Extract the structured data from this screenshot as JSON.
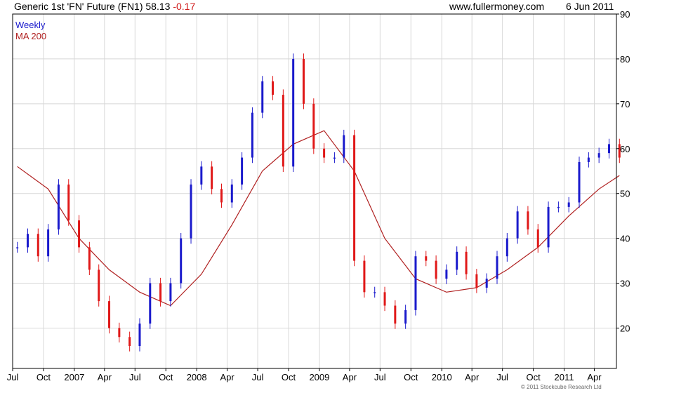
{
  "header": {
    "instrument": "Generic 1st 'FN' Future (FN1)",
    "last": "58.13",
    "change": "-0.17",
    "site": "www.fullermoney.com",
    "date": "6 Jun 2011"
  },
  "colors": {
    "up": "#1a1acc",
    "down": "#e01818",
    "ma": "#b02020",
    "grid": "#d8d8d8"
  },
  "copyright": "© 2011 Stockcube Research Ltd",
  "chart_data": {
    "type": "line",
    "title": "Generic 1st 'FN' Future (FN1) 58.13 -0.17",
    "legend": [
      "Weekly",
      "MA 200"
    ],
    "legend_position": "top-left",
    "ylim": [
      11,
      90
    ],
    "yticks": [
      20,
      30,
      40,
      50,
      60,
      70,
      80,
      90
    ],
    "grid": true,
    "xtick_labels": [
      "Jul",
      "Oct",
      "2007",
      "Apr",
      "Jul",
      "Oct",
      "2008",
      "Apr",
      "Jul",
      "Oct",
      "2009",
      "Apr",
      "Jul",
      "Oct",
      "2010",
      "Apr",
      "Jul",
      "Oct",
      "2011",
      "Apr"
    ],
    "x_start": "2006-07-01",
    "x_end": "2011-06-06",
    "series": [
      {
        "name": "Weekly",
        "x": [
          "2006-07",
          "2006-08",
          "2006-09",
          "2006-10",
          "2006-11",
          "2006-12",
          "2007-01",
          "2007-02",
          "2007-03",
          "2007-04",
          "2007-05",
          "2007-06",
          "2007-07",
          "2007-08",
          "2007-09",
          "2007-10",
          "2007-11",
          "2007-12",
          "2008-01",
          "2008-02",
          "2008-03",
          "2008-04",
          "2008-05",
          "2008-06",
          "2008-07",
          "2008-08",
          "2008-09",
          "2008-10",
          "2008-11",
          "2008-12",
          "2009-01",
          "2009-02",
          "2009-03",
          "2009-04",
          "2009-05",
          "2009-06",
          "2009-07",
          "2009-08",
          "2009-09",
          "2009-10",
          "2009-11",
          "2009-12",
          "2010-01",
          "2010-02",
          "2010-03",
          "2010-04",
          "2010-05",
          "2010-06",
          "2010-07",
          "2010-08",
          "2010-09",
          "2010-10",
          "2010-11",
          "2010-12",
          "2011-01",
          "2011-02",
          "2011-03",
          "2011-04",
          "2011-05",
          "2011-06"
        ],
        "values": [
          38,
          41,
          36,
          42,
          52,
          44,
          38,
          33,
          26,
          20,
          18,
          16,
          21,
          30,
          26,
          30,
          40,
          52,
          56,
          51,
          48,
          52,
          58,
          68,
          75,
          72,
          56,
          80,
          70,
          60,
          58,
          58,
          63,
          35,
          28,
          28,
          25,
          21,
          24,
          36,
          35,
          31,
          33,
          37,
          32,
          29,
          31,
          36,
          40,
          46,
          42,
          38,
          47,
          47,
          48,
          57,
          58,
          59,
          61,
          58
        ]
      },
      {
        "name": "MA 200",
        "x": [
          "2006-07",
          "2006-10",
          "2007-01",
          "2007-04",
          "2007-07",
          "2007-10",
          "2008-01",
          "2008-04",
          "2008-07",
          "2008-10",
          "2009-01",
          "2009-04",
          "2009-07",
          "2009-10",
          "2010-01",
          "2010-04",
          "2010-07",
          "2010-10",
          "2011-01",
          "2011-04",
          "2011-06"
        ],
        "values": [
          56,
          51,
          40,
          33,
          28,
          25,
          32,
          43,
          55,
          61,
          64,
          55,
          40,
          31,
          28,
          29,
          33,
          38,
          45,
          51,
          54
        ]
      }
    ]
  }
}
